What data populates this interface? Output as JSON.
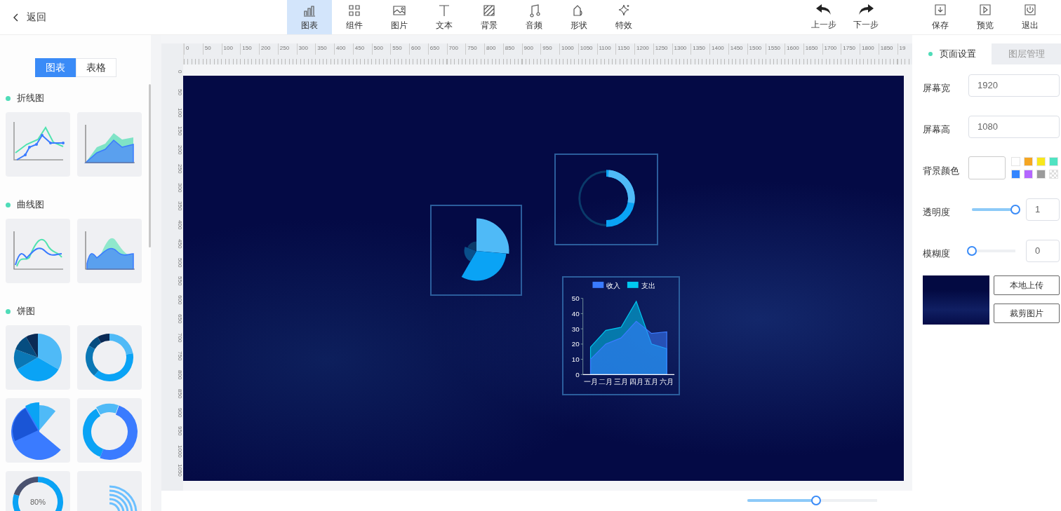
{
  "top_bar": {
    "back": "返回",
    "tools": [
      {
        "label": "图表",
        "selected": true
      },
      {
        "label": "组件",
        "selected": false
      },
      {
        "label": "图片",
        "selected": false
      },
      {
        "label": "文本",
        "selected": false
      },
      {
        "label": "背景",
        "selected": false
      },
      {
        "label": "音频",
        "selected": false
      },
      {
        "label": "形状",
        "selected": false
      },
      {
        "label": "特效",
        "selected": false
      }
    ],
    "history": [
      "上一步",
      "下一步"
    ],
    "actions": [
      "保存",
      "预览",
      "退出"
    ]
  },
  "left_panel": {
    "tabs": [
      {
        "label": "图表",
        "selected": true
      },
      {
        "label": "表格",
        "selected": false
      }
    ],
    "sections": [
      {
        "title": "折线图",
        "items": [
          {
            "kind": "line"
          },
          {
            "kind": "line-area"
          }
        ]
      },
      {
        "title": "曲线图",
        "items": [
          {
            "kind": "curve"
          },
          {
            "kind": "curve-area"
          }
        ]
      },
      {
        "title": "饼图",
        "items": [
          {
            "kind": "pie"
          },
          {
            "kind": "donut"
          },
          {
            "kind": "rose-pie"
          },
          {
            "kind": "rose-donut"
          },
          {
            "kind": "gauge",
            "label": "80%"
          },
          {
            "kind": "arcs"
          }
        ]
      }
    ]
  },
  "ruler": {
    "x_labels": [
      "0",
      "50",
      "100",
      "150",
      "200",
      "250",
      "300",
      "350",
      "400",
      "450",
      "500",
      "550",
      "600",
      "650",
      "700",
      "750",
      "800",
      "850",
      "900",
      "950",
      "1000",
      "1050",
      "1100",
      "1150",
      "1200",
      "1250",
      "1300",
      "1350",
      "1400",
      "1450",
      "1500",
      "1550",
      "1600",
      "1650",
      "1700",
      "1750",
      "1800",
      "1850",
      "19"
    ],
    "y_labels": [
      "0",
      "50",
      "100",
      "150",
      "200",
      "250",
      "300",
      "350",
      "400",
      "450",
      "500",
      "550",
      "600",
      "650",
      "700",
      "750",
      "800",
      "850",
      "900",
      "950",
      "1000",
      "1050"
    ]
  },
  "canvas": {
    "widgets": [
      {
        "kind": "pie"
      },
      {
        "kind": "donut"
      },
      {
        "kind": "area-chart",
        "chart_data": {
          "type": "area",
          "categories": [
            "一月",
            "二月",
            "三月",
            "四月",
            "五月",
            "六月"
          ],
          "series": [
            {
              "name": "收入",
              "color": "#3a7bff",
              "values": [
                10,
                20,
                24,
                35,
                27,
                28
              ]
            },
            {
              "name": "支出",
              "color": "#00c8f0",
              "values": [
                18,
                29,
                31,
                48,
                20,
                17
              ]
            }
          ],
          "legend": "top",
          "ylim": [
            0,
            50
          ],
          "yticks": [
            0,
            10,
            20,
            30,
            40,
            50
          ]
        }
      }
    ]
  },
  "zoom_slider": {
    "level": 0.53
  },
  "right_panel": {
    "tabs": [
      {
        "label": "页面设置",
        "selected": true
      },
      {
        "label": "图层管理",
        "selected": false
      }
    ],
    "fields": [
      {
        "label": "屏幕宽",
        "value": "1920"
      },
      {
        "label": "屏幕高",
        "value": "1080"
      }
    ],
    "background": {
      "label": "背景颜色",
      "swatches": [
        {
          "kind": "solid",
          "color": "#ffffff"
        },
        {
          "kind": "solid",
          "color": "#f5a623"
        },
        {
          "kind": "solid",
          "color": "#f8e71c"
        },
        {
          "kind": "solid",
          "color": "#50e3c2"
        },
        {
          "kind": "solid",
          "color": "#3385ff"
        },
        {
          "kind": "solid",
          "color": "#b466ff"
        },
        {
          "kind": "solid",
          "color": "#9b9b9b"
        },
        {
          "kind": "transparent"
        }
      ]
    },
    "sliders": [
      {
        "label": "透明度",
        "level": 1,
        "value": "1"
      },
      {
        "label": "模糊度",
        "level": 0,
        "value": "0"
      }
    ],
    "buttons": [
      "本地上传",
      "裁剪图片"
    ]
  }
}
